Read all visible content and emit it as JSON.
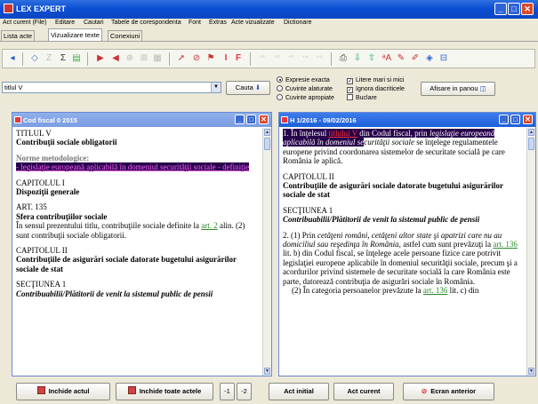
{
  "window": {
    "title": "LEX EXPERT"
  },
  "menu": [
    "Act curent (File)",
    "Editare",
    "Cautari",
    "Tabele de corespondenta",
    "Font",
    "Extras",
    "Acte vizualizate",
    "Dictionare"
  ],
  "tabs": [
    "Lista acte",
    "Vizualizare texte",
    "Conexiuni"
  ],
  "toolbar": {
    "letters": [
      "I",
      "F"
    ]
  },
  "search": {
    "value": "titlul V",
    "button": "Cauta",
    "options_mode": [
      {
        "label": "Expresie exacta",
        "selected": true
      },
      {
        "label": "Cuvinte alaturate",
        "selected": false
      },
      {
        "label": "Cuvinte apropiate",
        "selected": false
      }
    ],
    "checks": [
      {
        "label": "Litere mari si mici",
        "checked": true
      },
      {
        "label": "Ignora diacriticele",
        "checked": true
      },
      {
        "label": "Buclare",
        "checked": false
      }
    ],
    "panel_button": "Afisare in panou"
  },
  "left_panel": {
    "title": "Cod fiscal        0  2015",
    "heading1": "TITLUL V",
    "heading1_sub": "Contribuţii sociale obligatorii",
    "norms": "Norme metodologice:",
    "norm_link": "- legislaţie europeană aplicabilă în domeniul securităţii sociale - definiţie",
    "cap1": "CAPITOLUL I",
    "cap1_sub": "Dispoziţii generale",
    "art": "ART. 135",
    "art_sub": "Sfera contribuţiilor sociale",
    "art_text_1": "În sensul prezentului titlu, contribuţiile sociale definite la ",
    "art_link": "art. 2",
    "art_text_2": " alin. (2) sunt contribuţii sociale obligatorii.",
    "cap2": "CAPITOLUL II",
    "cap2_sub": "Contribuţiile de asigurări sociale datorate bugetului asigurărilor sociale de stat",
    "sec": "SECŢIUNEA 1",
    "sec_sub": "Contribuabilii/Plătitorii de venit la sistemul public de pensii"
  },
  "right_panel": {
    "title": "H 1/2016 - 09/02/2016",
    "p1_a": "1. În înţelesul ",
    "p1_link": "titlului V",
    "p1_b": " din Codul fiscal, prin ",
    "p1_c": "legislaţie europeană aplicabilă în domeniul se",
    "p1_d": "curităţii sociale",
    "p1_e": " se înţelege regulamentele europene privind coordonarea sistemelor de securitate socială pe care România le aplică.",
    "cap": "CAPITOLUL II",
    "cap_sub": "Contribuţiile de asigurări sociale datorate bugetului asigurărilor sociale de stat",
    "sec": "SECŢIUNEA 1",
    "sec_sub": "Contribuabilii/Plătitorii de venit la sistemul public de pensii",
    "p2_a": "2. (1) Prin ",
    "p2_b": "cetăţeni români, cetăţeni altor state şi apatrizi care nu au domiciliul sau reşedinţa în România",
    "p2_c": ", astfel cum sunt prevăzuţi la ",
    "p2_link": "art. 136",
    "p2_d": " lit. b) din Codul fiscal, se înţelege acele persoane fizice care potrivit legislaţiei europene aplicabile în domeniul securităţii sociale, precum şi a acordurilor privind sistemele de securitate socială la care România este parte, datorează contribuţia de asigurări sociale în România.",
    "p3_a": "(2) În categoria persoanelor prevăzute la ",
    "p3_link": "art. 136",
    "p3_b": " lit. c) din"
  },
  "bottom": {
    "close_act": "Inchide actul",
    "close_all": "Inchide toate actele",
    "minus1": "-1",
    "minus2": "-2",
    "first_act": "Act initial",
    "current_act": "Act curent",
    "prev_screen": "Ecran anterior"
  }
}
